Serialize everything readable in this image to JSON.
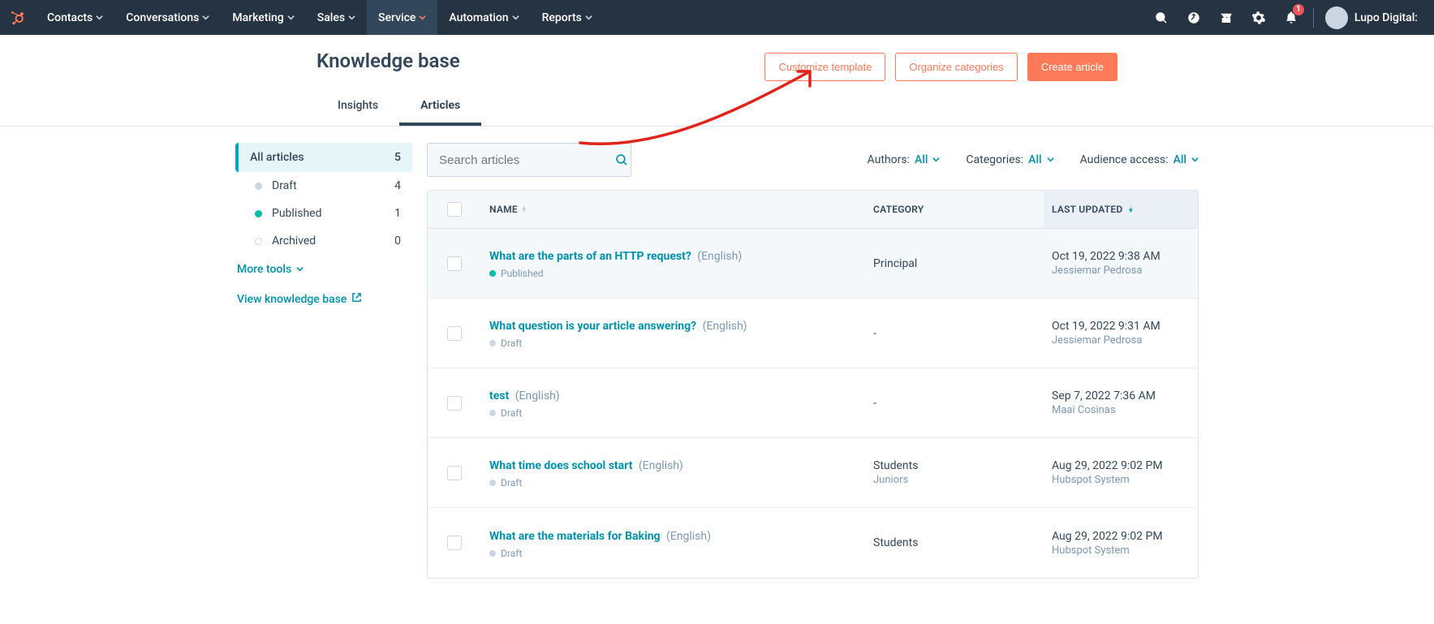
{
  "nav": {
    "items": [
      "Contacts",
      "Conversations",
      "Marketing",
      "Sales",
      "Service",
      "Automation",
      "Reports"
    ],
    "active_index": 4,
    "notification_badge": "1",
    "account_name": "Lupo Digital:"
  },
  "header": {
    "title": "Knowledge base",
    "actions": {
      "customize": "Customize template",
      "organize": "Organize categories",
      "create": "Create article"
    },
    "tabs": [
      {
        "label": "Insights"
      },
      {
        "label": "Articles"
      }
    ],
    "active_tab": 1
  },
  "sidebar": {
    "items": [
      {
        "label": "All articles",
        "count": "5",
        "dot": "none"
      },
      {
        "label": "Draft",
        "count": "4",
        "dot": "grey"
      },
      {
        "label": "Published",
        "count": "1",
        "dot": "pub"
      },
      {
        "label": "Archived",
        "count": "0",
        "dot": "arch"
      }
    ],
    "active_index": 0,
    "more_tools": "More tools",
    "view_kb": "View knowledge base"
  },
  "toolbar": {
    "search_placeholder": "Search articles"
  },
  "filters": {
    "authors_label": "Authors:",
    "authors_value": "All",
    "categories_label": "Categories:",
    "categories_value": "All",
    "audience_label": "Audience access:",
    "audience_value": "All"
  },
  "table": {
    "columns": {
      "name": "NAME",
      "category": "CATEGORY",
      "last_updated": "LAST UPDATED"
    },
    "rows": [
      {
        "title": "What are the parts of an HTTP request?",
        "lang": "(English)",
        "status": "Published",
        "status_kind": "pub",
        "category": "Principal",
        "subcategory": "",
        "date": "Oct 19, 2022 9:38 AM",
        "author": "Jessiemar Pedrosa"
      },
      {
        "title": "What question is your article answering?",
        "lang": "(English)",
        "status": "Draft",
        "status_kind": "grey",
        "category": "-",
        "subcategory": "",
        "date": "Oct 19, 2022 9:31 AM",
        "author": "Jessiemar Pedrosa"
      },
      {
        "title": "test",
        "lang": "(English)",
        "status": "Draft",
        "status_kind": "grey",
        "category": "-",
        "subcategory": "",
        "date": "Sep 7, 2022 7:36 AM",
        "author": "Maai Cosinas"
      },
      {
        "title": "What time does school start",
        "lang": "(English)",
        "status": "Draft",
        "status_kind": "grey",
        "category": "Students",
        "subcategory": "Juniors",
        "date": "Aug 29, 2022 9:02 PM",
        "author": "Hubspot System"
      },
      {
        "title": "What are the materials for Baking",
        "lang": "(English)",
        "status": "Draft",
        "status_kind": "grey",
        "category": "Students",
        "subcategory": "",
        "date": "Aug 29, 2022 9:02 PM",
        "author": "Hubspot System"
      }
    ]
  }
}
